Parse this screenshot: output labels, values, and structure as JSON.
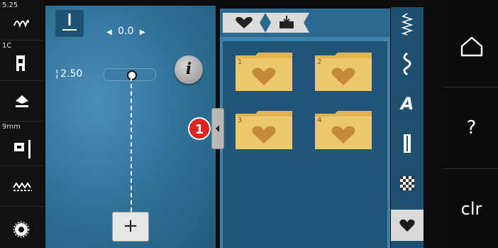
{
  "left_column": {
    "stitch_length_value": "5.25",
    "presser_foot_value": "1C",
    "needle_size_value": "9mm",
    "items": [
      {
        "name": "stitch-length-status",
        "icon": "stitch-loop-icon"
      },
      {
        "name": "presser-foot-status",
        "icon": "presser-foot-icon"
      },
      {
        "name": "needle-status",
        "icon": "needle-icon"
      },
      {
        "name": "needle-plate-status",
        "icon": "needle-plate-icon"
      },
      {
        "name": "feed-dog-status",
        "icon": "feed-dog-icon"
      },
      {
        "name": "bobbin-status",
        "icon": "bobbin-icon"
      }
    ]
  },
  "workspace": {
    "length_value": "0.0",
    "width_value": "2.50",
    "info_label": "i",
    "add_label": "+"
  },
  "panel": {
    "tabs": [
      {
        "name": "favorites-tab",
        "icon": "heart-icon"
      },
      {
        "name": "save-tab",
        "icon": "save-icon"
      }
    ],
    "folders": [
      {
        "number": "1"
      },
      {
        "number": "2"
      },
      {
        "number": "3"
      },
      {
        "number": "4"
      }
    ]
  },
  "callout": {
    "label": "1"
  },
  "categories": [
    {
      "name": "practical-stitches",
      "icon": "zigzag-icon"
    },
    {
      "name": "decorative-stitches",
      "icon": "wave-icon"
    },
    {
      "name": "alphabets",
      "icon": "letter-a-icon"
    },
    {
      "name": "buttonholes",
      "icon": "buttonhole-icon"
    },
    {
      "name": "quilt-stitches",
      "icon": "checker-icon"
    },
    {
      "name": "memory",
      "icon": "heart-icon",
      "active": true
    }
  ],
  "nav": {
    "home_icon": "home-icon",
    "help_label": "?",
    "clear_label": "clr"
  },
  "colors": {
    "workspace_blue": "#3a7eaa",
    "folder_yellow": "#e8c568",
    "heart_brown": "#c58a3a",
    "badge_red": "#e0231f"
  }
}
